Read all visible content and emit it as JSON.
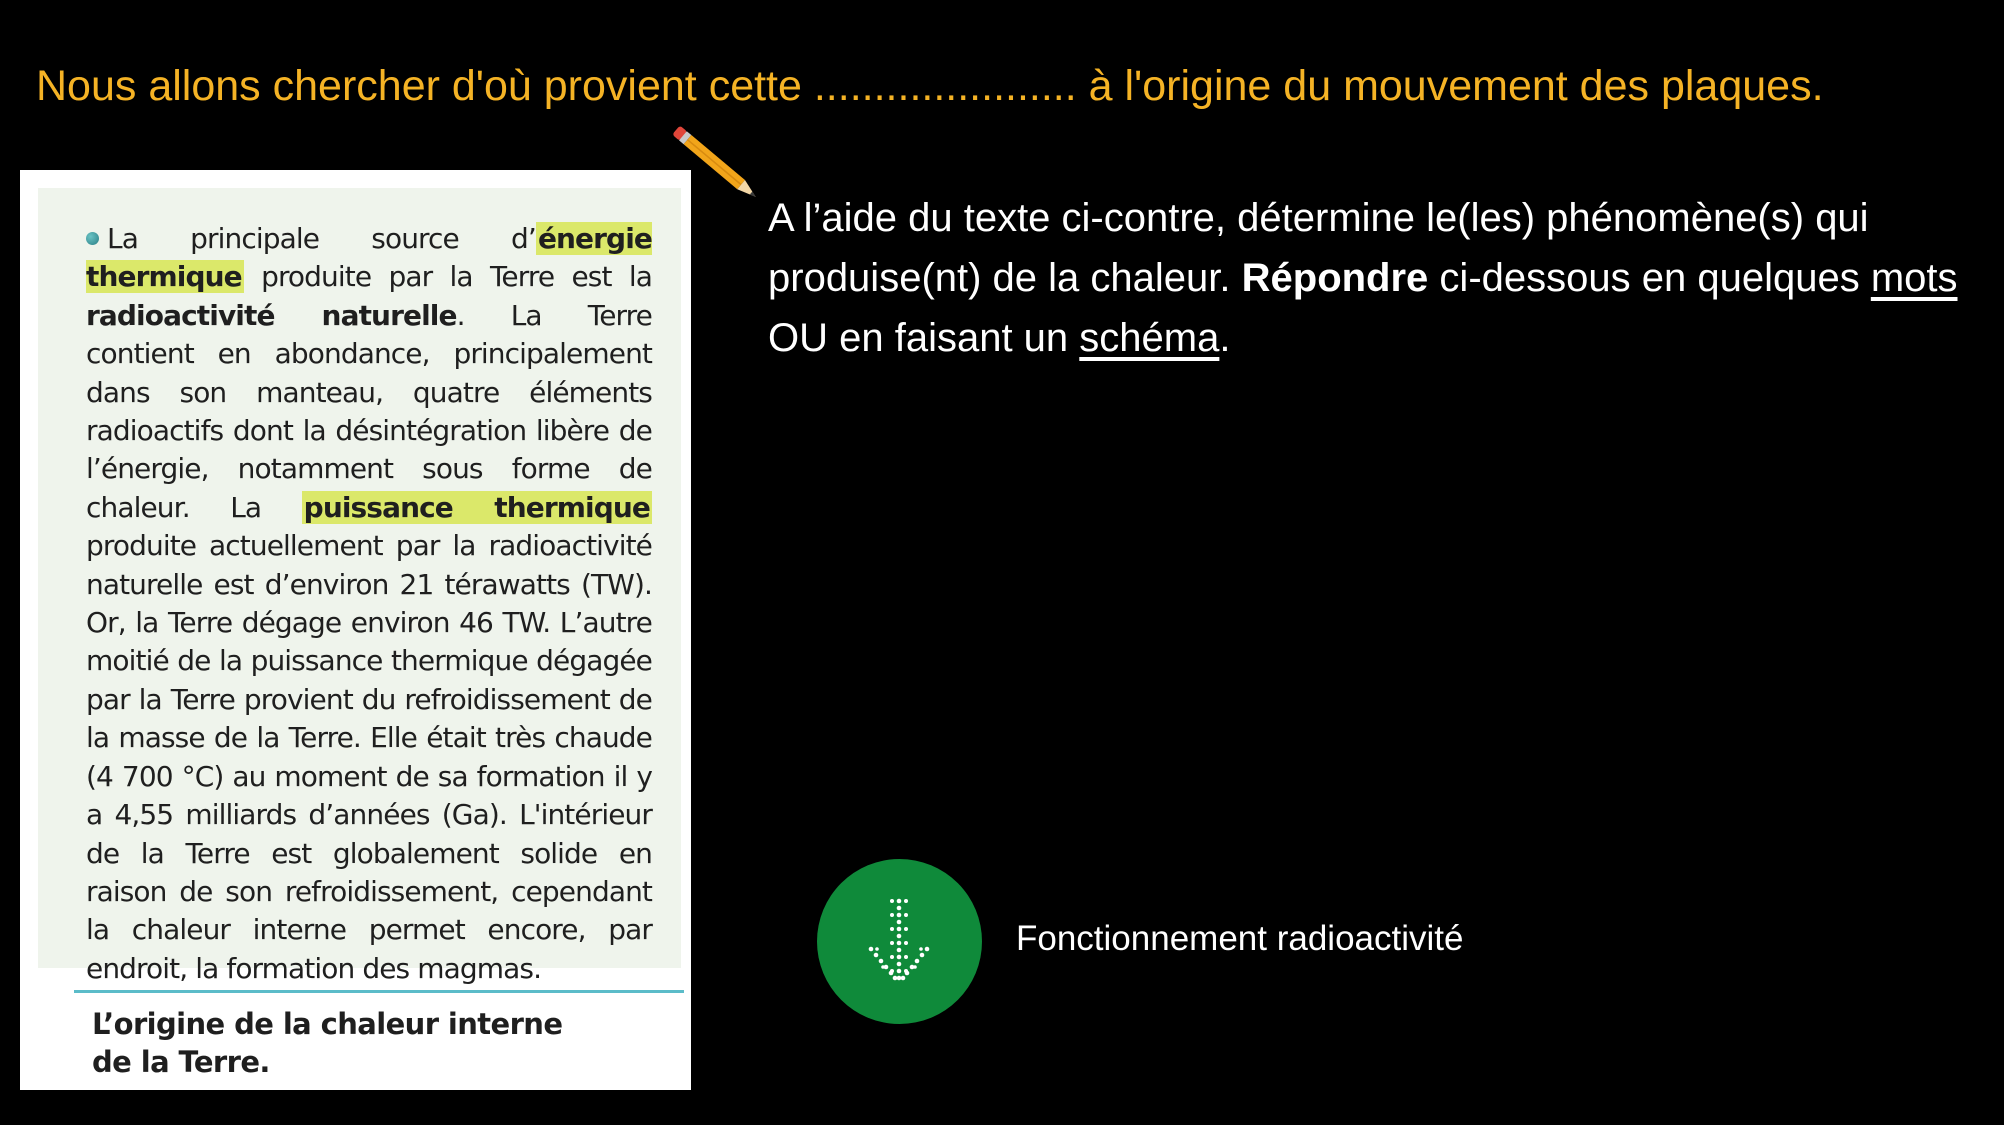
{
  "heading": {
    "text": "Nous allons chercher d'où provient cette ...................... à l'origine du mouvement des plaques.",
    "color": "#f5b325"
  },
  "document": {
    "paragraph": {
      "s1": "La principale source d’",
      "h1": "énergie thermique",
      "s2": " produite par la Terre est la ",
      "b1": "radioactivité naturelle",
      "s3": ". La Terre contient en abondance, principalement dans son manteau, quatre éléments radioactifs dont la désintégration libère de l’énergie, notamment sous forme de chaleur. La ",
      "h2": "puissance thermique",
      "s4": " produite actuellement par la radioactivité naturelle est d’environ 21 térawatts (TW). Or, la Terre dégage environ 46 TW. L’autre moitié de la puissance thermique dégagée par la Terre provient du refroidissement de la masse de la Terre. Elle était très chaude (4 700 °C) au moment de sa formation il y a 4,55 milliards d’années (Ga). L'intérieur de la Terre est globalement solide en raison de son refroidissement, cependant la chaleur interne permet encore, par endroit, la formation des magmas."
    },
    "caption_line1": "L’origine de la chaleur interne",
    "caption_line2": "de la Terre.",
    "highlight_color": "#dbe86a",
    "accent_color": "#5bbcc9"
  },
  "instruction": {
    "p1": "A l’aide du texte ci-contre, détermine le(les) phénomène(s) qui produise(nt) de la chaleur. ",
    "bold": "Répondre",
    "p2": " ci-dessous en quelques ",
    "u1": "mots",
    "p3": " OU en faisant un ",
    "u2": "schéma",
    "p4": "."
  },
  "audio": {
    "icon": "download-arrow-icon",
    "label": "Fonctionnement radioactivité",
    "color": "#0f8a3a"
  },
  "pencil_icon": "pencil-icon"
}
